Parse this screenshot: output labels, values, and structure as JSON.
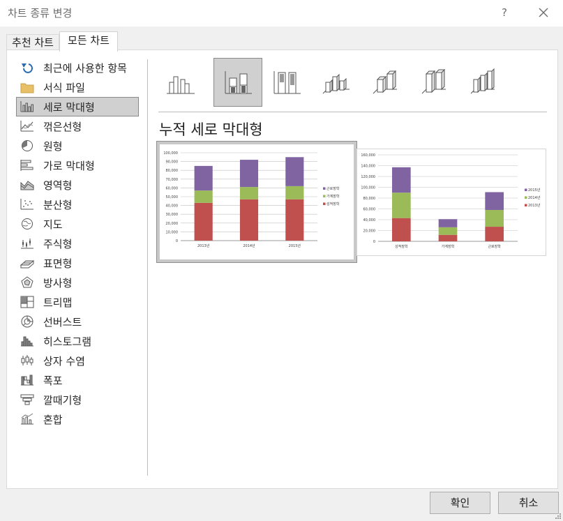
{
  "window": {
    "title": "차트 종류 변경",
    "help_label": "?"
  },
  "tabs": [
    {
      "label": "추천 차트"
    },
    {
      "label": "모든 차트"
    }
  ],
  "chart_types": [
    {
      "label": "최근에 사용한 항목",
      "icon": "recent-icon"
    },
    {
      "label": "서식 파일",
      "icon": "folder-icon"
    },
    {
      "label": "세로 막대형",
      "icon": "column-chart-icon",
      "selected": true
    },
    {
      "label": "꺾은선형",
      "icon": "line-chart-icon"
    },
    {
      "label": "원형",
      "icon": "pie-chart-icon"
    },
    {
      "label": "가로 막대형",
      "icon": "bar-chart-icon"
    },
    {
      "label": "영역형",
      "icon": "area-chart-icon"
    },
    {
      "label": "분산형",
      "icon": "scatter-chart-icon"
    },
    {
      "label": "지도",
      "icon": "map-chart-icon"
    },
    {
      "label": "주식형",
      "icon": "stock-chart-icon"
    },
    {
      "label": "표면형",
      "icon": "surface-chart-icon"
    },
    {
      "label": "방사형",
      "icon": "radar-chart-icon"
    },
    {
      "label": "트리맵",
      "icon": "treemap-chart-icon"
    },
    {
      "label": "선버스트",
      "icon": "sunburst-chart-icon"
    },
    {
      "label": "히스토그램",
      "icon": "histogram-chart-icon"
    },
    {
      "label": "상자 수염",
      "icon": "box-whisker-chart-icon"
    },
    {
      "label": "폭포",
      "icon": "waterfall-chart-icon"
    },
    {
      "label": "깔때기형",
      "icon": "funnel-chart-icon"
    },
    {
      "label": "혼합",
      "icon": "combo-chart-icon"
    }
  ],
  "subtype_heading": "누적 세로 막대형",
  "buttons": {
    "ok": "확인",
    "cancel": "취소"
  },
  "colors": {
    "series1": "#c0504d",
    "series2": "#9bbb59",
    "series3": "#8064a2",
    "selection": "#d0d0d0"
  },
  "chart_data": [
    {
      "type": "bar",
      "stacked": true,
      "categories": [
        "2013년",
        "2014년",
        "2015년"
      ],
      "series": [
        {
          "name": "성적장학",
          "values": [
            43000,
            47000,
            47000
          ]
        },
        {
          "name": "가계장학",
          "values": [
            14000,
            14000,
            15000
          ]
        },
        {
          "name": "근로장학",
          "values": [
            28000,
            31000,
            33000
          ]
        }
      ],
      "ylim": [
        0,
        100000
      ],
      "yticks": [
        "100,000",
        "90,000",
        "80,000",
        "70,000",
        "60,000",
        "50,000",
        "40,000",
        "30,000",
        "20,000",
        "10,000",
        "0"
      ],
      "legend": "right",
      "grid": true
    },
    {
      "type": "bar",
      "stacked": true,
      "categories": [
        "성적장학",
        "가계장학",
        "근로장학"
      ],
      "series": [
        {
          "name": "2013년",
          "values": [
            43000,
            12000,
            27000
          ]
        },
        {
          "name": "2014년",
          "values": [
            47000,
            14000,
            31000
          ]
        },
        {
          "name": "2015년",
          "values": [
            47000,
            15000,
            33000
          ]
        }
      ],
      "ylim": [
        0,
        160000
      ],
      "yticks": [
        "160,000",
        "140,000",
        "120,000",
        "100,000",
        "80,000",
        "60,000",
        "40,000",
        "20,000",
        "0"
      ],
      "legend": "right",
      "grid": true
    }
  ]
}
